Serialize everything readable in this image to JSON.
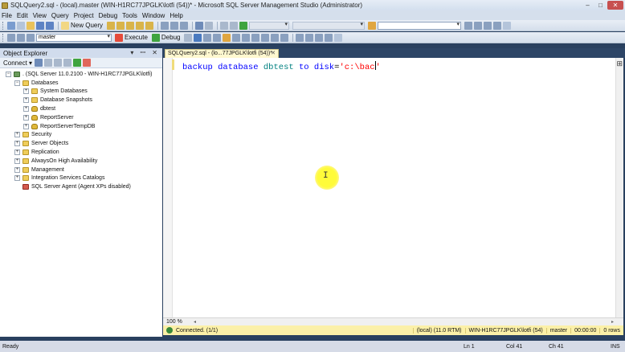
{
  "window": {
    "title": "SQLQuery2.sql - (local).master (WIN-H1RC77JPGLK\\lotfi (54))* - Microsoft SQL Server Management Studio (Administrator)",
    "controls": {
      "minimize": "–",
      "maximize": "□",
      "close": "✕"
    }
  },
  "menu": [
    "File",
    "Edit",
    "View",
    "Query",
    "Project",
    "Debug",
    "Tools",
    "Window",
    "Help"
  ],
  "toolbar": {
    "new_query": "New Query",
    "database": "master",
    "execute": "Execute",
    "debug": "Debug"
  },
  "object_explorer": {
    "title": "Object Explorer",
    "pins": "▾ ꟷ ✕",
    "connect": "Connect ▾",
    "tree": [
      {
        "label": ". (SQL Server 11.0.2100 - WIN-H1RC77JPGLK\\lotfi)",
        "expander": "⊟",
        "icon": "server-icon",
        "level": 0
      },
      {
        "label": "Databases",
        "expander": "⊟",
        "icon": "folder-icon",
        "level": 1
      },
      {
        "label": "System Databases",
        "expander": "⊞",
        "icon": "folder-icon",
        "level": 2
      },
      {
        "label": "Database Snapshots",
        "expander": "⊞",
        "icon": "folder-icon",
        "level": 2
      },
      {
        "label": "dbtest",
        "expander": "⊞",
        "icon": "database-icon",
        "level": 2
      },
      {
        "label": "ReportServer",
        "expander": "⊞",
        "icon": "database-icon",
        "level": 2
      },
      {
        "label": "ReportServerTempDB",
        "expander": "⊞",
        "icon": "database-icon",
        "level": 2
      },
      {
        "label": "Security",
        "expander": "⊞",
        "icon": "folder-icon",
        "level": 1
      },
      {
        "label": "Server Objects",
        "expander": "⊞",
        "icon": "folder-icon",
        "level": 1
      },
      {
        "label": "Replication",
        "expander": "⊞",
        "icon": "folder-icon",
        "level": 1
      },
      {
        "label": "AlwaysOn High Availability",
        "expander": "⊞",
        "icon": "folder-icon",
        "level": 1
      },
      {
        "label": "Management",
        "expander": "⊞",
        "icon": "folder-icon",
        "level": 1
      },
      {
        "label": "Integration Services Catalogs",
        "expander": "⊞",
        "icon": "folder-icon",
        "level": 1
      },
      {
        "label": "SQL Server Agent (Agent XPs disabled)",
        "expander": "",
        "icon": "agent-icon",
        "level": 1
      }
    ]
  },
  "document_tab": {
    "label": "SQLQuery2.sql - (lo...77JPGLK\\lotfi (54))*",
    "close": "✕"
  },
  "editor": {
    "code": {
      "kw1": "backup",
      "kw2": "database",
      "ident": "dbtest",
      "kw3": "to",
      "kw4": "disk",
      "eq": "=",
      "string": "'c:\\bac",
      "string_end": "'"
    }
  },
  "zoom": "100 %",
  "query_status": {
    "connected": "Connected. (1/1)",
    "server": "(local) (11.0 RTM)",
    "user": "WIN-H1RC77JPGLK\\lotfi (54)",
    "database": "master",
    "time": "00:00:00",
    "rows": "0 rows"
  },
  "statusbar": {
    "ready": "Ready",
    "ln": "Ln 1",
    "col": "Col 41",
    "ch": "Ch 41",
    "mode": "INS"
  }
}
